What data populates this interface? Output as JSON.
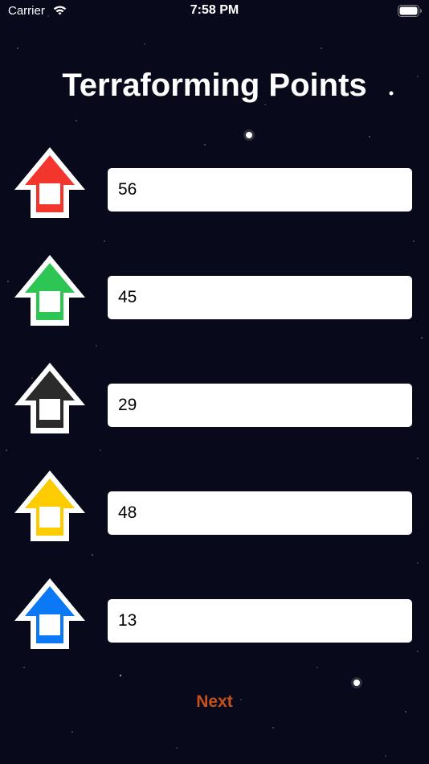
{
  "status_bar": {
    "carrier": "Carrier",
    "time": "7:58 PM",
    "wifi_icon": "wifi-icon",
    "battery_icon": "battery-icon"
  },
  "title": "Terraforming Points",
  "players": [
    {
      "color": "#f2352d",
      "icon": "red-player-arrow-icon",
      "points": "56"
    },
    {
      "color": "#2dc553",
      "icon": "green-player-arrow-icon",
      "points": "45"
    },
    {
      "color": "#2b2b2b",
      "icon": "black-player-arrow-icon",
      "points": "29"
    },
    {
      "color": "#fccb00",
      "icon": "yellow-player-arrow-icon",
      "points": "48"
    },
    {
      "color": "#0b78f5",
      "icon": "blue-player-arrow-icon",
      "points": "13"
    }
  ],
  "next_button": {
    "label": "Next",
    "color": "#c4501c"
  },
  "colors": {
    "background": "#080a1c"
  }
}
